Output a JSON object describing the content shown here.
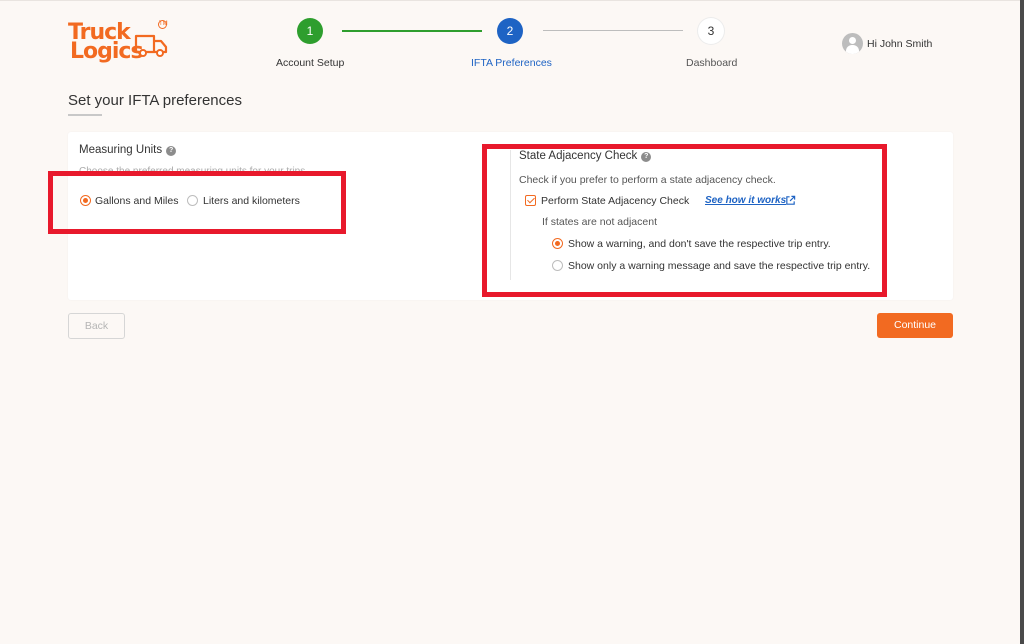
{
  "logo": {
    "line1": "Truck",
    "line2": "Logics",
    "tm": "TM"
  },
  "stepper": {
    "steps": [
      {
        "number": "1",
        "label": "Account Setup",
        "status": "complete"
      },
      {
        "number": "2",
        "label": "IFTA Preferences",
        "status": "active"
      },
      {
        "number": "3",
        "label": "Dashboard",
        "status": "upcoming"
      }
    ]
  },
  "user": {
    "greeting": "Hi John Smith"
  },
  "page": {
    "title": "Set your IFTA preferences"
  },
  "measuring_units": {
    "title": "Measuring Units",
    "help": "?",
    "description": "Choose the preferred measuring units for your trips.",
    "options": [
      {
        "label": "Gallons and Miles",
        "selected": true
      },
      {
        "label": "Liters and kilometers",
        "selected": false
      }
    ]
  },
  "state_adjacency": {
    "title": "State Adjacency Check",
    "help": "?",
    "description": "Check if you prefer to perform a state adjacency check.",
    "checkbox_label": "Perform State Adjacency Check",
    "checkbox_checked": true,
    "link_label": "See how it works",
    "sub_label": "If states are not adjacent",
    "options": [
      {
        "label": "Show a warning, and don't save the respective trip entry.",
        "selected": true
      },
      {
        "label": "Show only a warning message and save the respective trip entry.",
        "selected": false
      }
    ]
  },
  "buttons": {
    "back": "Back",
    "continue": "Continue"
  },
  "colors": {
    "accent": "#f26a21",
    "step_complete": "#2e9e2e",
    "step_active": "#1e63c4",
    "annotation": "#e8192c"
  }
}
